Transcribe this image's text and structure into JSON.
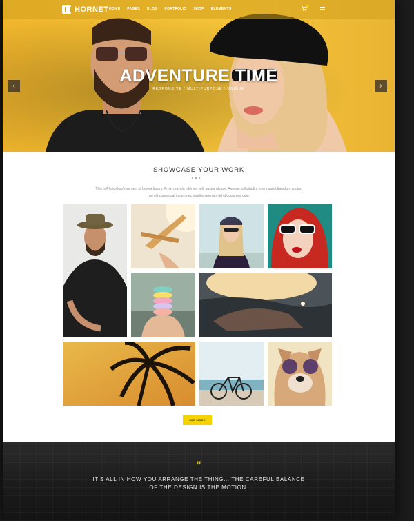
{
  "brand": {
    "name": "HORNET",
    "accent": "#f5d300"
  },
  "nav": {
    "items": [
      "HOME",
      "PAGES",
      "BLOG",
      "PORTFOLIO",
      "SHOP",
      "ELEMENTS"
    ]
  },
  "hero": {
    "title": "ADVENTURE TIME",
    "subtitle": "RESPONSIVE / MULTIPURPOSE / UNIQUE"
  },
  "showcase": {
    "title": "SHOWCASE YOUR WORK",
    "text_line1": "This is Photoshop's version of Lorem Ipsum. Proin gravida nibh vel velit auctor aliquet. Aenean sollicitudin, lorem quis bibendum auctor,",
    "text_line2": "nisi elit consequat ipsum nec sagittis sem nibh id elit duis sed odio.",
    "button": "SEE MORE"
  },
  "quote": {
    "mark": "”",
    "line1": "IT'S ALL IN HOW YOU ARRANGE THE THING... THE CAREFUL BALANCE",
    "line2": "OF THE DESIGN IS THE MOTION."
  }
}
